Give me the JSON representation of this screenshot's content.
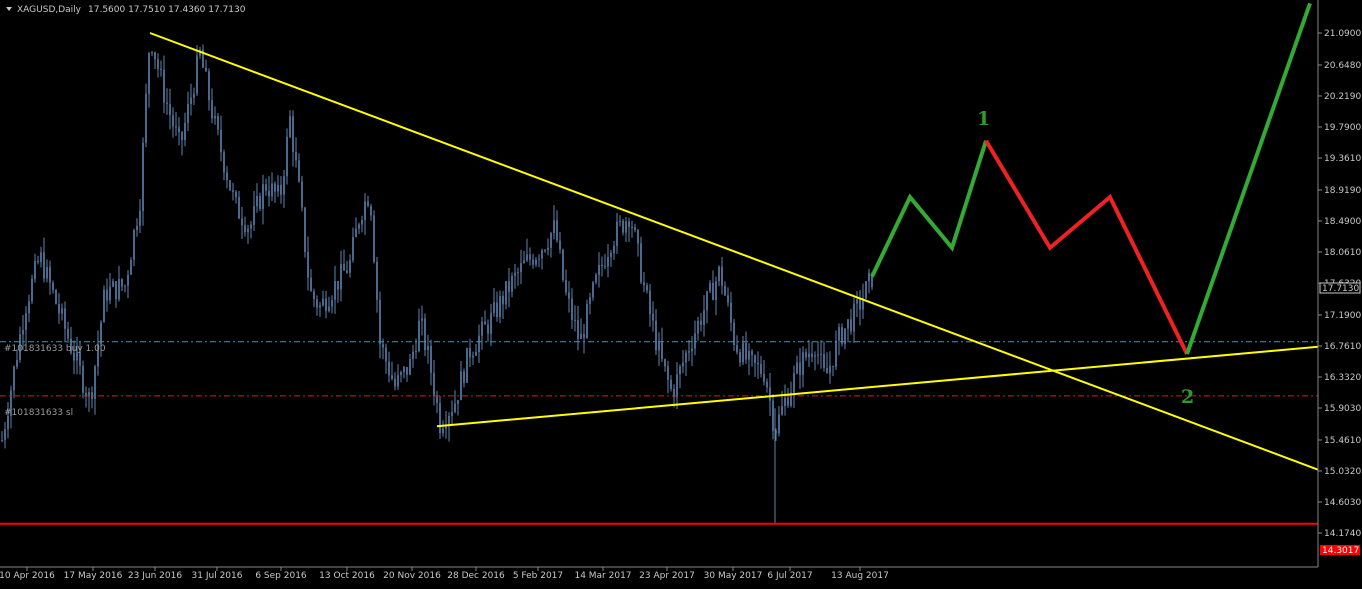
{
  "header": {
    "symbol": "XAGUSD,Daily",
    "ohlc": "17.5600 17.7510 17.4360 17.7130"
  },
  "chart_data": {
    "type": "candlestick",
    "yaxis": {
      "ticks": [
        "21.0900",
        "20.6480",
        "20.2190",
        "19.7900",
        "19.3610",
        "18.9190",
        "18.4900",
        "18.0610",
        "17.6320",
        "17.1900",
        "16.7610",
        "16.3320",
        "15.9030",
        "15.4610",
        "15.0320",
        "14.6030",
        "14.1740"
      ],
      "range": [
        14.174,
        21.09
      ]
    },
    "xaxis": {
      "ticks": [
        "10 Apr 2016",
        "17 May 2016",
        "23 Jun 2016",
        "31 Jul 2016",
        "6 Sep 2016",
        "13 Oct 2016",
        "20 Nov 2016",
        "28 Dec 2016",
        "5 Feb 2017",
        "14 Mar 2017",
        "23 Apr 2017",
        "30 May 2017",
        "6 Jul 2017",
        "13 Aug 2017"
      ]
    },
    "price_path": [
      [
        0,
        15.3
      ],
      [
        10,
        16.1
      ],
      [
        25,
        17.3
      ],
      [
        40,
        18.0
      ],
      [
        55,
        17.4
      ],
      [
        70,
        16.8
      ],
      [
        90,
        16.0
      ],
      [
        105,
        17.5
      ],
      [
        125,
        17.6
      ],
      [
        140,
        18.8
      ],
      [
        150,
        21.09
      ],
      [
        165,
        20.2
      ],
      [
        180,
        19.5
      ],
      [
        200,
        20.8
      ],
      [
        215,
        19.8
      ],
      [
        235,
        18.7
      ],
      [
        250,
        18.4
      ],
      [
        265,
        19.0
      ],
      [
        280,
        18.8
      ],
      [
        290,
        19.9
      ],
      [
        300,
        18.8
      ],
      [
        310,
        17.5
      ],
      [
        320,
        17.3
      ],
      [
        335,
        17.6
      ],
      [
        350,
        17.9
      ],
      [
        360,
        18.6
      ],
      [
        370,
        18.9
      ],
      [
        380,
        16.8
      ],
      [
        395,
        16.2
      ],
      [
        410,
        16.5
      ],
      [
        420,
        17.1
      ],
      [
        430,
        16.5
      ],
      [
        440,
        15.7
      ],
      [
        455,
        16.0
      ],
      [
        470,
        16.7
      ],
      [
        490,
        17.1
      ],
      [
        510,
        17.6
      ],
      [
        525,
        17.9
      ],
      [
        540,
        18.1
      ],
      [
        555,
        18.4
      ],
      [
        565,
        17.5
      ],
      [
        580,
        16.8
      ],
      [
        595,
        17.6
      ],
      [
        610,
        18.2
      ],
      [
        630,
        18.6
      ],
      [
        645,
        17.5
      ],
      [
        660,
        16.6
      ],
      [
        672,
        16.1
      ],
      [
        690,
        16.8
      ],
      [
        705,
        17.3
      ],
      [
        720,
        17.8
      ],
      [
        735,
        16.8
      ],
      [
        750,
        16.5
      ],
      [
        765,
        16.4
      ],
      [
        775,
        15.6
      ],
      [
        785,
        16.0
      ],
      [
        800,
        16.5
      ],
      [
        815,
        16.8
      ],
      [
        825,
        16.3
      ],
      [
        840,
        16.9
      ],
      [
        855,
        17.2
      ],
      [
        872,
        17.713
      ]
    ],
    "spike_low": {
      "x_index": 775,
      "value": 14.3
    },
    "level_labels": {
      "buy": "#101831633 buy 1.00",
      "sl": "#101831633 sl",
      "current": "17.7130",
      "bottom": "14.3017"
    },
    "levels": {
      "buy": 16.82,
      "sl": 16.07,
      "bottom": 14.3017
    },
    "trendlines": {
      "resistance": [
        [
          150,
          21.09
        ],
        [
          1318,
          15.05
        ]
      ],
      "support": [
        [
          437,
          15.65
        ],
        [
          1318,
          16.75
        ]
      ]
    },
    "forecast_up": [
      [
        872,
        17.72
      ],
      [
        910,
        18.82
      ],
      [
        952,
        18.12
      ],
      [
        986,
        19.6
      ]
    ],
    "forecast_down": [
      [
        986,
        19.6
      ],
      [
        1050,
        18.12
      ],
      [
        1110,
        18.82
      ],
      [
        1187,
        16.65
      ]
    ],
    "forecast_rally": [
      [
        1187,
        16.65
      ],
      [
        1310,
        21.5
      ]
    ],
    "wave_labels": {
      "one": "1",
      "two": "2"
    },
    "colors": {
      "background": "#000000",
      "candles": "#5b84b1",
      "trendline": "#ffff00",
      "wave_up": "#33aa33",
      "wave_down": "#ee2222",
      "buy_line": "#4a90b0",
      "sl_line": "#cc2222",
      "bottom_line": "#ff0000",
      "wave_label": "#2e9b2e"
    }
  }
}
